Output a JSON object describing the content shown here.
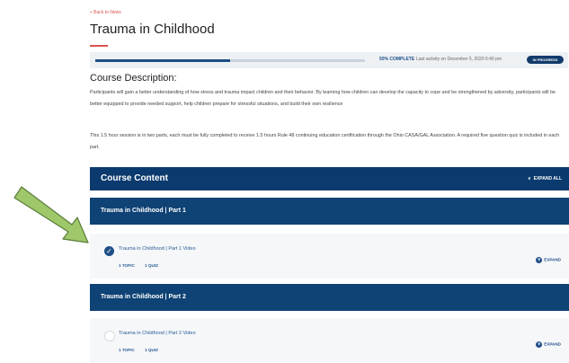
{
  "back_link": "« Back to News",
  "page_title": "Trauma in Childhood",
  "progress": {
    "fraction": 0.5,
    "complete_label": "50% COMPLETE",
    "last_activity": "Last activity on December 5, 2020 6:40 pm",
    "status": "IN PROGRESS"
  },
  "description": {
    "heading": "Course Description:",
    "text": "Participants will gain a better understanding of how stress and trauma impact children and their behavior.  By learning how children can develop the capacity to cope and be strengthened by adversity,  participants will be better equipped to provide needed support, help children prepare for stressful situations, and build their own resilience",
    "session_info": "This 1.5 hour session is in two parts, each must be fully completed to receive 1.5 hours Rule 48 continuing education certification through the Ohio CASA/GAL Association.  A required five question quiz is included in each part."
  },
  "course_content": {
    "title": "Course Content",
    "expand_all": "EXPAND ALL"
  },
  "parts": [
    {
      "title": "Trauma in Childhood | Part 1",
      "lesson": {
        "title": "Trauma in Childhood | Part 1 Video",
        "topics": "1 TOPIC",
        "quizzes": "1 QUIZ",
        "expand": "EXPAND",
        "completed": true
      }
    },
    {
      "title": "Trauma in Childhood | Part 2",
      "lesson": {
        "title": "Trauma in Childhood | Part 2 Video",
        "topics": "1 TOPIC",
        "quizzes": "1 QUIZ",
        "expand": "EXPAND",
        "completed": false
      }
    }
  ],
  "colors": {
    "primary": "#0b3a6e",
    "accent": "#d9534f",
    "arrow_fill": "#9fc86a"
  },
  "icons": {
    "check": "check-circle-icon",
    "expand": "chevron-down-icon",
    "arrow": "arrow-annotation-icon"
  }
}
